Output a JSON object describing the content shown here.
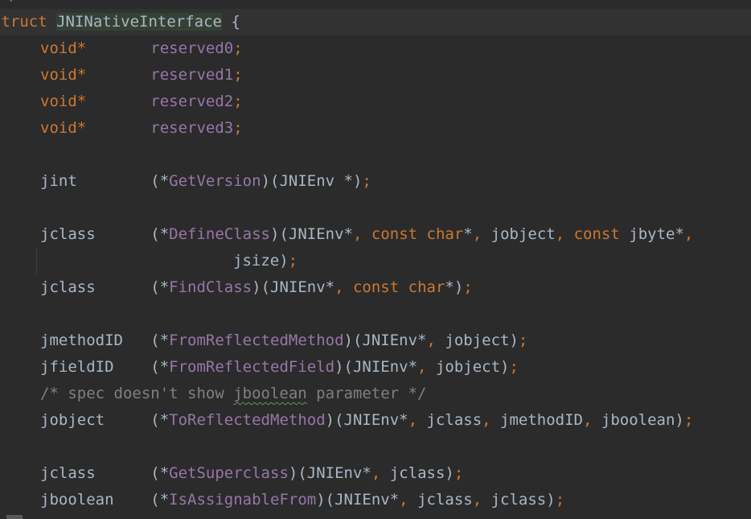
{
  "editor": {
    "top_partial": "*/",
    "struct_keyword": "struct",
    "struct_name": "JNINativeInterface",
    "open_brace": "{",
    "reserved": [
      {
        "type": "void*",
        "name": "reserved0"
      },
      {
        "type": "void*",
        "name": "reserved1"
      },
      {
        "type": "void*",
        "name": "reserved2"
      },
      {
        "type": "void*",
        "name": "reserved3"
      }
    ],
    "get_version": {
      "ret": "jint",
      "fn": "GetVersion",
      "args": "JNIEnv *"
    },
    "define_class": {
      "ret": "jclass",
      "fn": "DefineClass",
      "arg1": "JNIEnv*",
      "arg2_kw": "const",
      "arg2_kw2": "char",
      "arg2_tail": "*",
      "arg3": "jobject",
      "arg4_kw": "const",
      "arg4_tail": "jbyte*",
      "cont": "jsize"
    },
    "find_class": {
      "ret": "jclass",
      "fn": "FindClass",
      "arg1": "JNIEnv*",
      "arg2_kw": "const",
      "arg2_kw2": "char",
      "arg2_tail": "*"
    },
    "from_reflected_method": {
      "ret": "jmethodID",
      "fn": "FromReflectedMethod",
      "arg1": "JNIEnv*",
      "arg2": "jobject"
    },
    "from_reflected_field": {
      "ret": "jfieldID",
      "fn": "FromReflectedField",
      "arg1": "JNIEnv*",
      "arg2": "jobject"
    },
    "comment": {
      "pre": "/* spec doesn't show ",
      "word": "jboolean",
      "post": " parameter */"
    },
    "to_reflected_method": {
      "ret": "jobject",
      "fn": "ToReflectedMethod",
      "arg1": "JNIEnv*",
      "arg2": "jclass",
      "arg3": "jmethodID",
      "arg4": "jboolean"
    },
    "get_superclass": {
      "ret": "jclass",
      "fn": "GetSuperclass",
      "arg1": "JNIEnv*",
      "arg2": "jclass"
    },
    "is_assignable_from": {
      "ret": "jboolean",
      "fn": "IsAssignableFrom",
      "arg1": "JNIEnv*",
      "arg2": "jclass",
      "arg3": "jclass"
    }
  },
  "colors": {
    "background": "#2b2b2b",
    "keyword": "#cc7832",
    "field": "#9876aa",
    "default_text": "#a9b7c6",
    "comment": "#808080"
  }
}
